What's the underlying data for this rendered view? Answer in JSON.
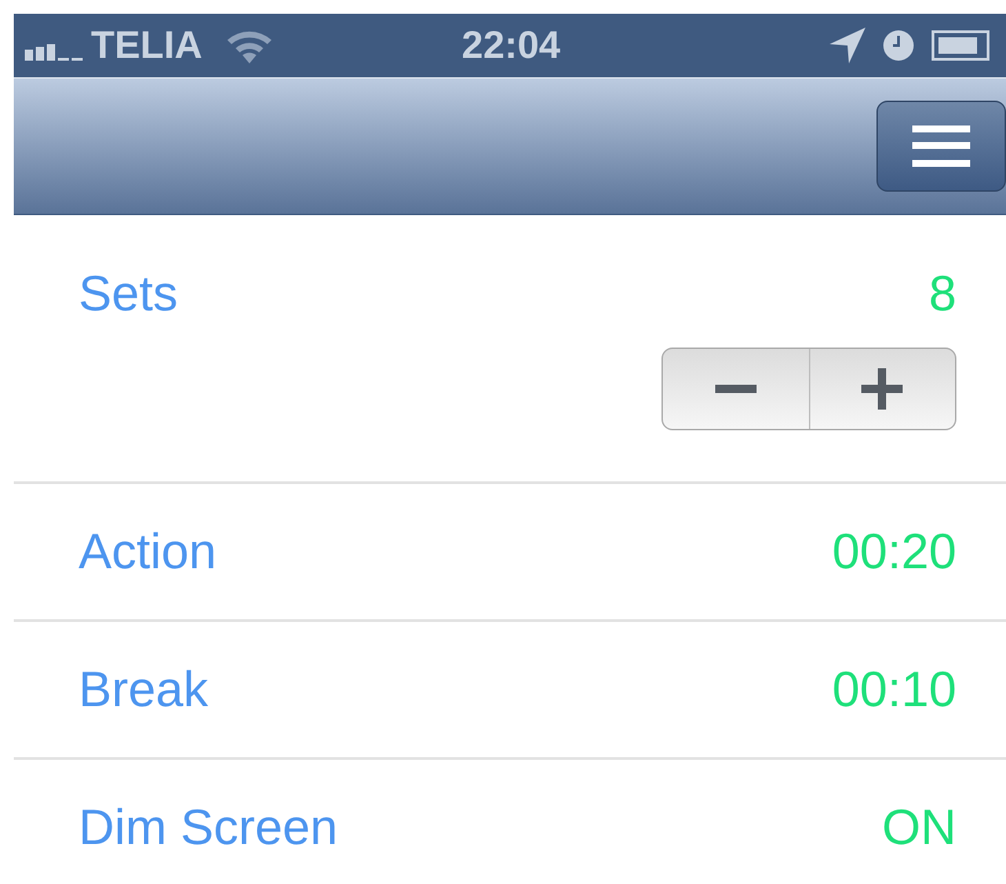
{
  "status_bar": {
    "carrier": "TELIA",
    "time": "22:04"
  },
  "settings": [
    {
      "kind": "stepper",
      "label": "Sets",
      "value": "8"
    },
    {
      "kind": "plain",
      "label": "Action",
      "value": "00:20"
    },
    {
      "kind": "plain",
      "label": "Break",
      "value": "00:10"
    },
    {
      "kind": "plain",
      "label": "Dim Screen",
      "value": "ON"
    }
  ]
}
